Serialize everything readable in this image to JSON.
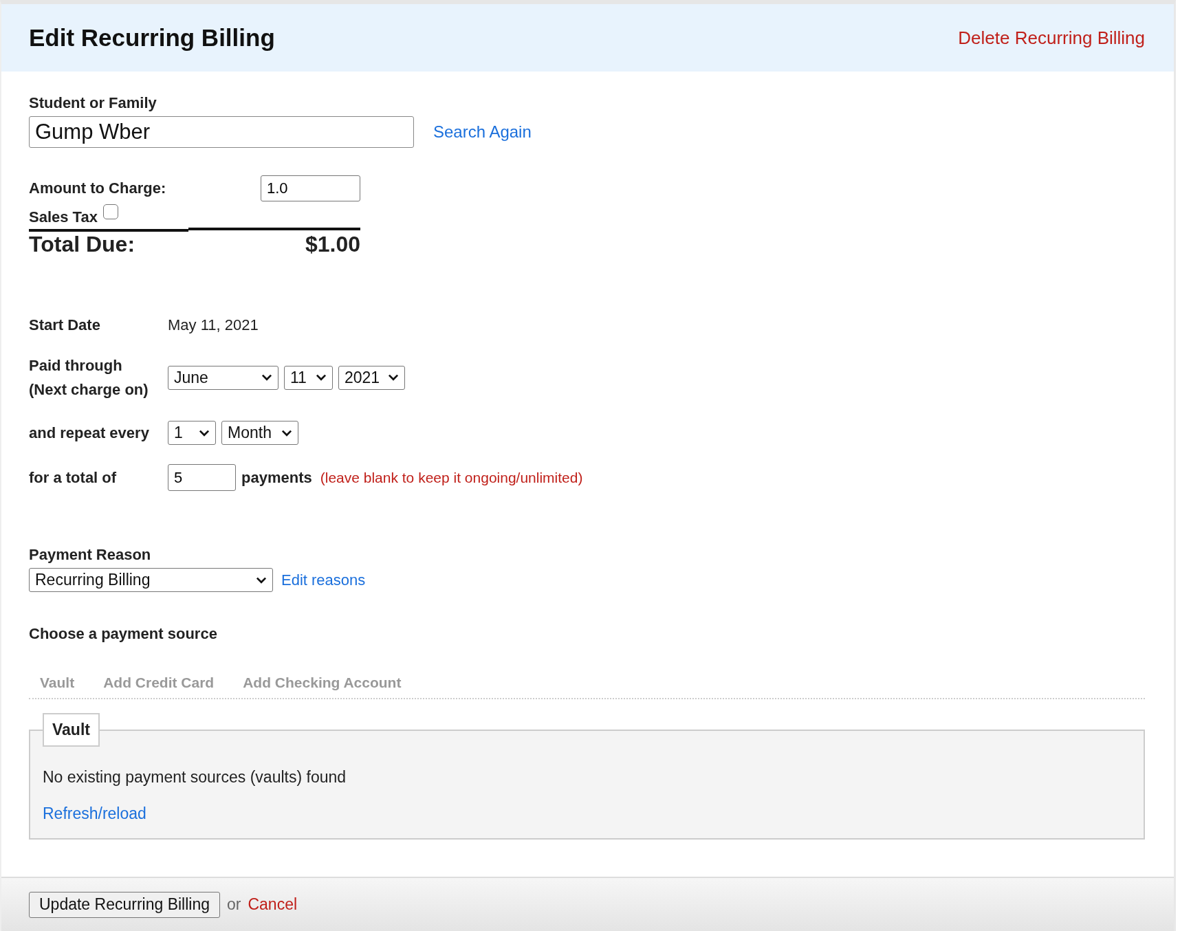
{
  "header": {
    "title": "Edit Recurring Billing",
    "delete_link": "Delete Recurring Billing"
  },
  "student": {
    "label": "Student or Family",
    "value": "Gump Wber",
    "search_link": "Search Again"
  },
  "amount": {
    "label": "Amount to Charge:",
    "value": "1.0"
  },
  "sales_tax": {
    "label": "Sales Tax",
    "checked": false
  },
  "total": {
    "label": "Total Due:",
    "value": "$1.00"
  },
  "schedule": {
    "start_label": "Start Date",
    "start_value": "May 11, 2021",
    "paid_label_1": "Paid through",
    "paid_label_2": "(Next charge on)",
    "paid_month": "June",
    "paid_day": "11",
    "paid_year": "2021",
    "repeat_label": "and repeat every",
    "repeat_count": "1",
    "repeat_unit": "Month",
    "total_label": "for a total of",
    "total_value": "5",
    "payments_label": "payments",
    "hint": "(leave blank to keep it ongoing/unlimited)"
  },
  "reason": {
    "label": "Payment Reason",
    "value": "Recurring Billing",
    "edit_link": "Edit reasons"
  },
  "source": {
    "heading": "Choose a payment source",
    "tabs": [
      "Vault",
      "Add Credit Card",
      "Add Checking Account"
    ],
    "panel": {
      "legend": "Vault",
      "message": "No existing payment sources (vaults) found",
      "refresh_link": "Refresh/reload"
    }
  },
  "footer": {
    "submit": "Update Recurring Billing",
    "or": "or",
    "cancel": "Cancel"
  }
}
